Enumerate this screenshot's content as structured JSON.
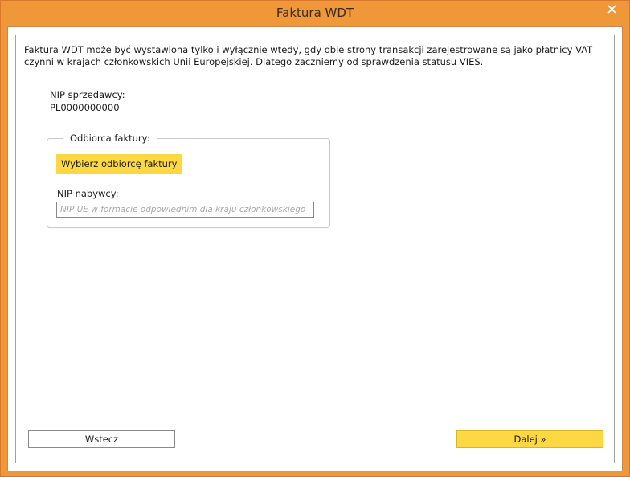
{
  "window": {
    "title": "Faktura WDT",
    "close_icon": "close-icon",
    "accent_color": "#f0973a"
  },
  "intro": {
    "text": "Faktura WDT może być wystawiona tylko i wyłącznie wtedy, gdy obie strony transakcji zarejestrowane są jako płatnicy VAT czynni w krajach członkowskich Unii Europejskiej. Dlatego zaczniemy od sprawdzenia statusu VIES."
  },
  "seller": {
    "label": "NIP sprzedawcy:",
    "value": "PL0000000000"
  },
  "recipient": {
    "group_label": "Odbiorca faktury:",
    "choose_button": "Wybierz odbiorcę faktury",
    "buyer_label": "NIP nabywcy:",
    "buyer_value": "",
    "buyer_placeholder": "NIP UE w formacie odpowiednim dla kraju członkowskiego",
    "button_color": "#fdd843"
  },
  "footer": {
    "back_label": "Wstecz",
    "next_label": "Dalej »"
  }
}
